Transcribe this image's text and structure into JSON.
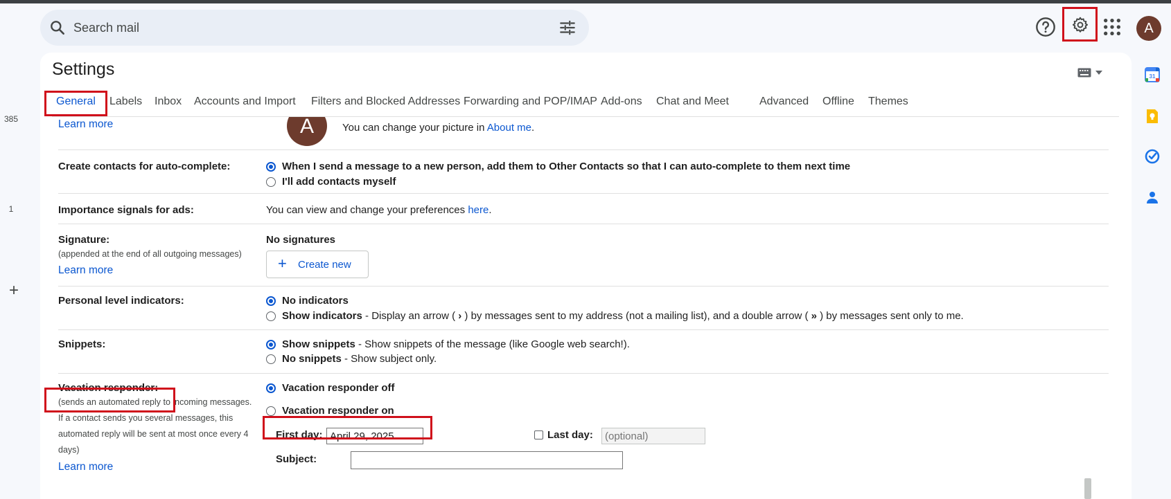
{
  "search": {
    "placeholder": "Search mail"
  },
  "rail": {
    "count_top": "385",
    "count_mid": "1",
    "add": "+"
  },
  "account": {
    "avatar_letter": "A"
  },
  "settings": {
    "title": "Settings",
    "tabs": [
      "General",
      "Labels",
      "Inbox",
      "Accounts and Import",
      "Filters and Blocked Addresses",
      "Forwarding and POP/IMAP",
      "Add-ons",
      "Chat and Meet",
      "Advanced",
      "Offline",
      "Themes"
    ],
    "active_tab": "General"
  },
  "picture": {
    "learn_more": "Learn more",
    "avatar_letter": "A",
    "change_text": "You can change your picture in",
    "about_me": "About me",
    "period": "."
  },
  "contacts": {
    "label": "Create contacts for auto-complete:",
    "option_1": "When I send a message to a new person, add them to Other Contacts so that I can auto-complete to them next time",
    "option_2": "I'll add contacts myself",
    "selected": 1
  },
  "importance": {
    "label": "Importance signals for ads:",
    "text": "You can view and change your preferences",
    "link": "here",
    "period": "."
  },
  "signature": {
    "label": "Signature:",
    "sub": "(appended at the end of all outgoing messages)",
    "learn_more": "Learn more",
    "status": "No signatures",
    "create_button": "Create new"
  },
  "personal_indicators": {
    "label": "Personal level indicators:",
    "option_1": "No indicators",
    "option_2_bold": "Show indicators",
    "option_2_desc_a": " - Display an arrow ( ",
    "arrow_single": "›",
    "option_2_desc_b": " ) by messages sent to my address (not a mailing list), and a double arrow ( ",
    "arrow_double": "»",
    "option_2_desc_c": " ) by messages sent only to me.",
    "selected": 1
  },
  "snippets": {
    "label": "Snippets:",
    "option_1_bold": "Show snippets",
    "option_1_desc": " - Show snippets of the message (like Google web search!).",
    "option_2_bold": "No snippets",
    "option_2_desc": " - Show subject only.",
    "selected": 1
  },
  "vacation": {
    "label": "Vacation responder:",
    "sub_1": "(sends an automated reply to incoming messages.",
    "sub_2": "If a contact sends you several messages, this",
    "sub_3": "automated reply will be sent at most once every 4",
    "sub_4": "days)",
    "learn_more": "Learn more",
    "option_off": "Vacation responder off",
    "option_on": "Vacation responder on",
    "selected": "off",
    "first_day_label": "First day:",
    "first_day_value": "April 29, 2025",
    "last_day_label": "Last day:",
    "last_day_placeholder": "(optional)",
    "subject_label": "Subject:",
    "subject_value": ""
  },
  "colors": {
    "accent": "#0b57d0",
    "highlight": "#d0101b",
    "avatar": "#6d3b2d"
  },
  "icons": [
    "search-icon",
    "tune-icon",
    "help-icon",
    "gear-icon",
    "apps-icon",
    "keyboard-icon",
    "calendar-icon",
    "keep-icon",
    "tasks-icon",
    "contacts-icon"
  ]
}
